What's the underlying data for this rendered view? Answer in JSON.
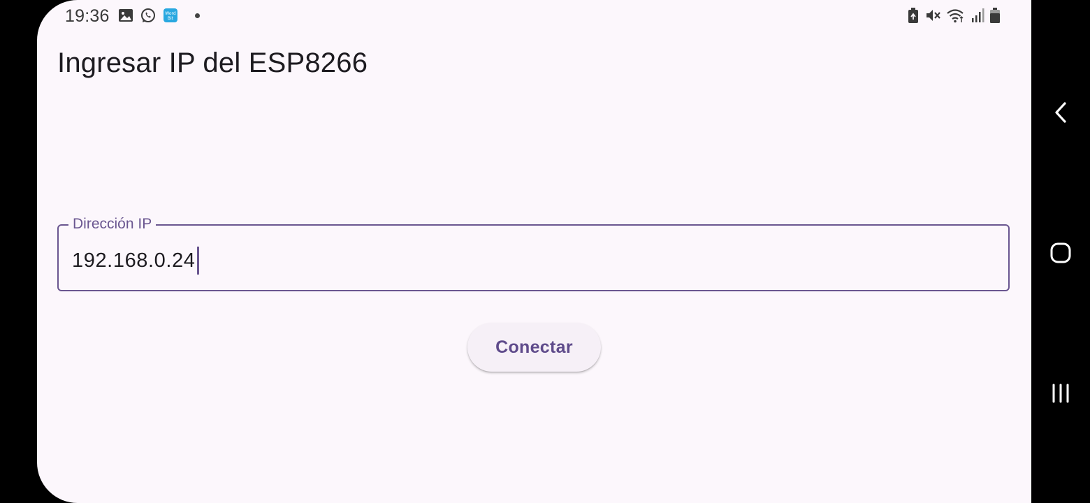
{
  "status_bar": {
    "time": "19:36",
    "left_icons": [
      "image-icon",
      "whatsapp-icon",
      "wordbit-icon"
    ],
    "right_icons": [
      "battery-saver-icon",
      "vibrate-mute-icon",
      "wifi-icon",
      "signal-icon",
      "battery-icon"
    ]
  },
  "app_bar": {
    "title": "Ingresar IP del ESP8266"
  },
  "form": {
    "ip_field": {
      "label": "Dirección IP",
      "value": "192.168.0.24"
    },
    "connect_button": {
      "label": "Conectar"
    }
  },
  "nav_bar": {
    "buttons": [
      "back-icon",
      "home-icon",
      "recents-icon"
    ]
  },
  "colors": {
    "background": "#fcf7fc",
    "accent": "#6a5690",
    "button_text": "#5f4b8b",
    "button_bg": "#f6f0f7",
    "text": "#1d1b20"
  }
}
